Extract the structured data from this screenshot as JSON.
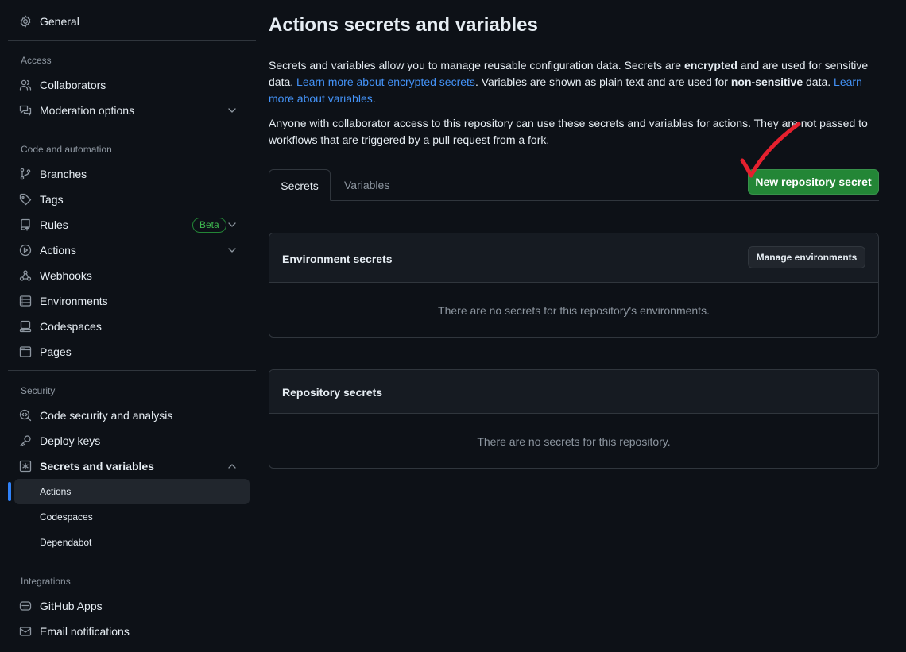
{
  "sidebar": {
    "general": "General",
    "sections": {
      "access": "Access",
      "code_automation": "Code and automation",
      "security": "Security",
      "integrations": "Integrations"
    },
    "items": {
      "collaborators": "Collaborators",
      "moderation": "Moderation options",
      "branches": "Branches",
      "tags": "Tags",
      "rules": "Rules",
      "rules_badge": "Beta",
      "actions": "Actions",
      "webhooks": "Webhooks",
      "environments": "Environments",
      "codespaces": "Codespaces",
      "pages": "Pages",
      "code_security": "Code security and analysis",
      "deploy_keys": "Deploy keys",
      "secrets_vars": "Secrets and variables",
      "sub_actions": "Actions",
      "sub_codespaces": "Codespaces",
      "sub_dependabot": "Dependabot",
      "github_apps": "GitHub Apps",
      "email_notifications": "Email notifications"
    }
  },
  "main": {
    "title": "Actions secrets and variables",
    "intro": {
      "t1": "Secrets and variables allow you to manage reusable configuration data. Secrets are ",
      "b1": "encrypted",
      "t2": " and are used for sensitive data. ",
      "link1": "Learn more about encrypted secrets",
      "t3": ". Variables are shown as plain text and are used for ",
      "b2": "non-sensitive",
      "t4": " data. ",
      "link2": "Learn more about variables",
      "t5": "."
    },
    "notice": "Anyone with collaborator access to this repository can use these secrets and variables for actions. They are not passed to workflows that are triggered by a pull request from a fork.",
    "tabs": {
      "secrets": "Secrets",
      "variables": "Variables"
    },
    "new_secret_button": "New repository secret",
    "env_box": {
      "title": "Environment secrets",
      "button": "Manage environments",
      "empty": "There are no secrets for this repository's environments."
    },
    "repo_box": {
      "title": "Repository secrets",
      "empty": "There are no secrets for this repository."
    }
  },
  "colors": {
    "accent": "#2f81f7",
    "primary_button": "#238636",
    "annotation": "#e5202e"
  }
}
